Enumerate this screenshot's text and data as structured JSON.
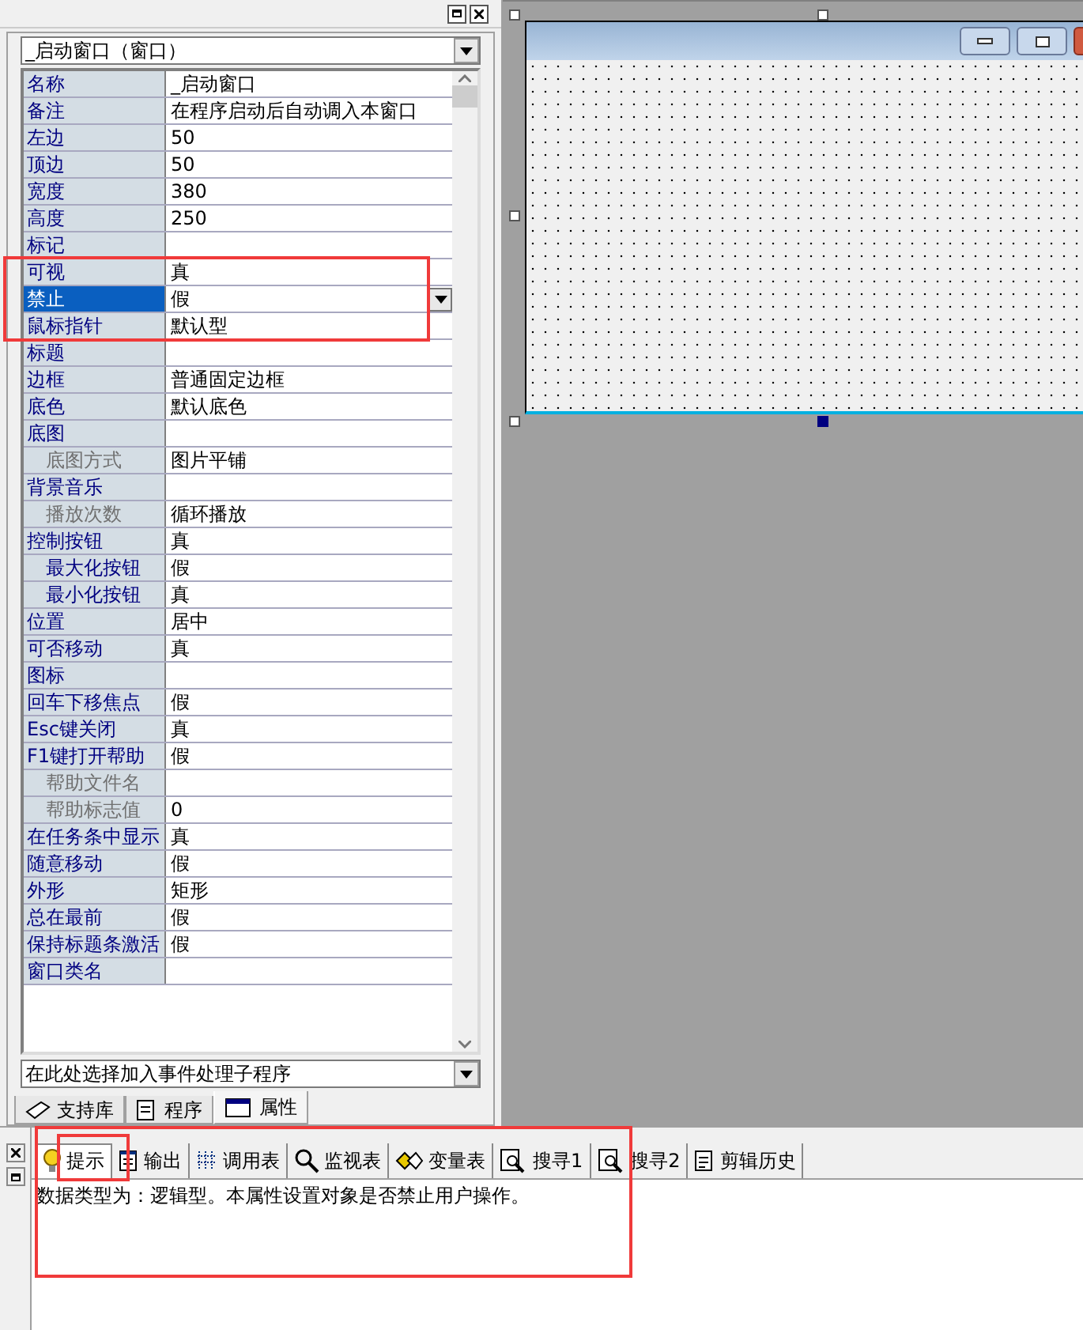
{
  "object_combo": {
    "value": "_启动窗口（窗口）"
  },
  "properties": [
    {
      "label": "名称",
      "value": "_启动窗口",
      "kind": "main",
      "selected": false
    },
    {
      "label": "备注",
      "value": "在程序启动后自动调入本窗口",
      "kind": "main",
      "selected": false
    },
    {
      "label": "左边",
      "value": "50",
      "kind": "main",
      "selected": false
    },
    {
      "label": "顶边",
      "value": "50",
      "kind": "main",
      "selected": false
    },
    {
      "label": "宽度",
      "value": "380",
      "kind": "main",
      "selected": false
    },
    {
      "label": "高度",
      "value": "250",
      "kind": "main",
      "selected": false
    },
    {
      "label": "标记",
      "kind": "main",
      "selected": false
    },
    {
      "label": "可视",
      "value": "真",
      "kind": "main",
      "selected": false
    },
    {
      "label": "禁止",
      "value": "假",
      "kind": "main",
      "selected": true
    },
    {
      "label": "鼠标指针",
      "value": "默认型",
      "kind": "main",
      "selected": false
    },
    {
      "label": "标题",
      "kind": "main",
      "selected": false
    },
    {
      "label": "边框",
      "value": "普通固定边框",
      "kind": "main",
      "selected": false
    },
    {
      "label": "底色",
      "value": "默认底色",
      "kind": "main",
      "selected": false
    },
    {
      "label": "底图",
      "kind": "main",
      "selected": false
    },
    {
      "label": "底图方式",
      "value": "图片平铺",
      "kind": "sub",
      "selected": false
    },
    {
      "label": "背景音乐",
      "kind": "main",
      "selected": false
    },
    {
      "label": "播放次数",
      "value": "循环播放",
      "kind": "sub",
      "selected": false
    },
    {
      "label": "控制按钮",
      "value": "真",
      "kind": "main",
      "selected": false
    },
    {
      "label": "最大化按钮",
      "value": "假",
      "kind": "child",
      "selected": false
    },
    {
      "label": "最小化按钮",
      "value": "真",
      "kind": "child",
      "selected": false
    },
    {
      "label": "位置",
      "value": "居中",
      "kind": "main",
      "selected": false
    },
    {
      "label": "可否移动",
      "value": "真",
      "kind": "main",
      "selected": false
    },
    {
      "label": "图标",
      "kind": "main",
      "selected": false
    },
    {
      "label": "回车下移焦点",
      "value": "假",
      "kind": "main",
      "selected": false
    },
    {
      "label": "Esc键关闭",
      "value": "真",
      "kind": "main",
      "selected": false
    },
    {
      "label": "F1键打开帮助",
      "value": "假",
      "kind": "main",
      "selected": false
    },
    {
      "label": "帮助文件名",
      "kind": "sub",
      "selected": false
    },
    {
      "label": "帮助标志值",
      "value": "0",
      "kind": "sub",
      "selected": false
    },
    {
      "label": "在任务条中显示",
      "value": "真",
      "kind": "main",
      "selected": false
    },
    {
      "label": "随意移动",
      "value": "假",
      "kind": "main",
      "selected": false
    },
    {
      "label": "外形",
      "value": "矩形",
      "kind": "main",
      "selected": false
    },
    {
      "label": "总在最前",
      "value": "假",
      "kind": "main",
      "selected": false
    },
    {
      "label": "保持标题条激活",
      "value": "假",
      "kind": "main",
      "selected": false
    },
    {
      "label": "窗口类名",
      "kind": "main",
      "selected": false
    }
  ],
  "event_combo": {
    "value": "在此处选择加入事件处理子程序"
  },
  "panel_tabs": [
    {
      "label": "支持库",
      "selected": false
    },
    {
      "label": "程序",
      "selected": false
    },
    {
      "label": "属性",
      "selected": true
    }
  ],
  "output_tabs": [
    {
      "label": "提示",
      "selected": true
    },
    {
      "label": "输出",
      "selected": false
    },
    {
      "label": "调用表",
      "selected": false
    },
    {
      "label": "监视表",
      "selected": false
    },
    {
      "label": "变量表",
      "selected": false
    },
    {
      "label": "搜寻1",
      "selected": false
    },
    {
      "label": "搜寻2",
      "selected": false
    },
    {
      "label": "剪辑历史",
      "selected": false
    }
  ],
  "hint_text": "数据类型为：逻辑型。本属性设置对象是否禁止用户操作。"
}
